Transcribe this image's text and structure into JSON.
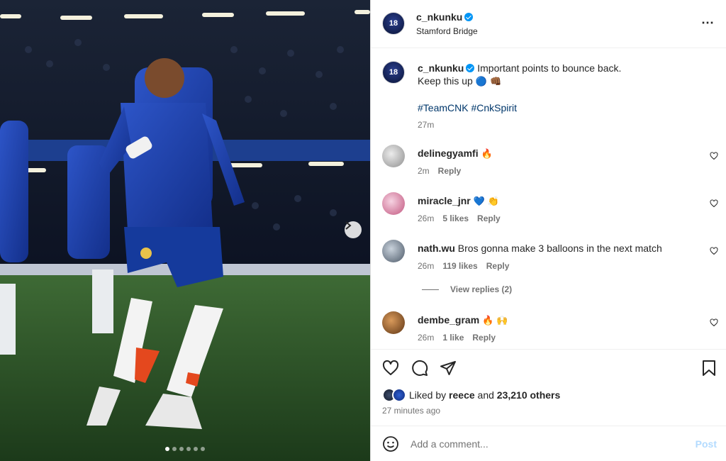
{
  "post": {
    "username": "c_nkunku",
    "location": "Stamford Bridge",
    "avatar_number": "18",
    "caption_line1": "Important points to bounce back.",
    "caption_line2": "Keep this up",
    "caption_emoji": "🔵 👊🏾",
    "hashtags": "#TeamCNK #CnkSpirit",
    "caption_time": "27m",
    "more_icon": "⋯",
    "carousel": {
      "dot_count": 6,
      "active_index": 0
    }
  },
  "comments": [
    {
      "username": "delinegyamfi",
      "text": "",
      "emoji": "🔥",
      "time": "2m",
      "likes": "",
      "reply": "Reply",
      "avatar_color": "#cfcfcf"
    },
    {
      "username": "miracle_jnr",
      "text": "",
      "emoji": "💙 👏",
      "time": "26m",
      "likes": "5 likes",
      "reply": "Reply",
      "avatar_color": "#e79bbd"
    },
    {
      "username": "nath.wu",
      "text": "Bros gonna make 3 balloons in the next match",
      "emoji": "",
      "time": "26m",
      "likes": "119 likes",
      "reply": "Reply",
      "avatar_color": "#6b7b8c"
    },
    {
      "username": "dembe_gram",
      "text": "",
      "emoji": "🔥 🙌",
      "time": "26m",
      "likes": "1 like",
      "reply": "Reply",
      "avatar_color": "#8a5a2b"
    }
  ],
  "view_replies": "View replies (2)",
  "likes": {
    "prefix": "Liked by",
    "user": "reece",
    "connector": "and",
    "others": "23,210 others"
  },
  "time_ago": "27 minutes ago",
  "add_comment": {
    "placeholder": "Add a comment...",
    "post_label": "Post"
  },
  "colors": {
    "verified": "#0095f6",
    "link": "#00376b",
    "muted": "#737373",
    "post_disabled": "#b3dbff"
  }
}
